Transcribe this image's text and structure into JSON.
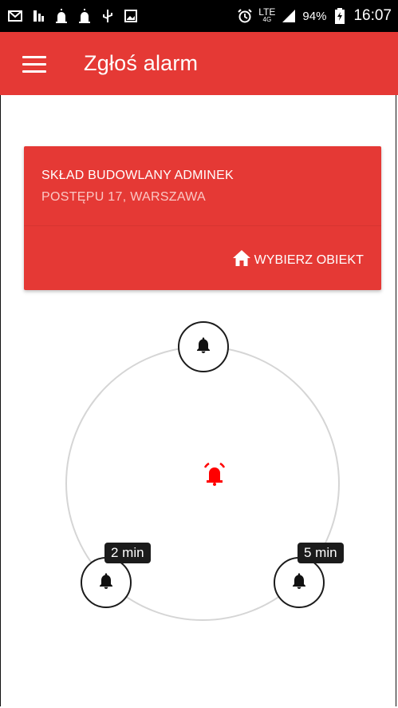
{
  "status_bar": {
    "icons": [
      "mail-icon",
      "app-icon",
      "siren-icon",
      "siren-icon",
      "usb-icon",
      "image-icon",
      "alarm-clock-icon",
      "lte-icon",
      "signal-icon",
      "battery-icon"
    ],
    "lte_label": "LTE",
    "lte_sub": "4G",
    "battery_percent": "94%",
    "time": "16:07"
  },
  "app_bar": {
    "title": "Zgłoś alarm",
    "color": "#e53935"
  },
  "location_card": {
    "name": "SKŁAD BUDOWLANY ADMINEK",
    "address": "POSTĘPU 17,  WARSZAWA",
    "action_label": "WYBIERZ OBIEKT",
    "action_icon": "home-icon"
  },
  "alarm_ring": {
    "center_icon": "alarm-ringing-icon",
    "center_color": "#ff0000",
    "nodes": [
      {
        "icon": "bell-icon",
        "badge": ""
      },
      {
        "icon": "bell-icon",
        "badge": "2 min"
      },
      {
        "icon": "bell-icon",
        "badge": "5 min"
      }
    ]
  }
}
